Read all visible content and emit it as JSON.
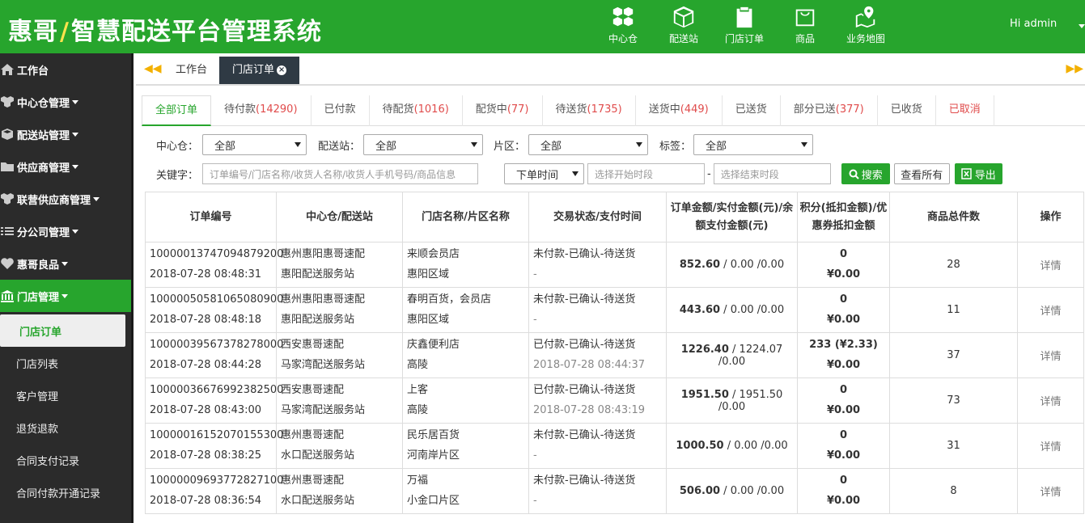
{
  "header": {
    "logo_main": "惠哥",
    "logo_bolt": "/",
    "logo_rest": "智慧配送平台管理系统",
    "nav": [
      {
        "label": "中心仓",
        "icon": "cubes-icon"
      },
      {
        "label": "配送站",
        "icon": "cube-icon"
      },
      {
        "label": "门店订单",
        "icon": "clipboard-icon"
      },
      {
        "label": "商品",
        "icon": "shopping-bag-icon"
      },
      {
        "label": "业务地图",
        "icon": "map-icon"
      }
    ],
    "user": "Hi admin"
  },
  "sidebar": {
    "items": [
      {
        "label": "工作台",
        "icon": "home-icon"
      },
      {
        "label": "中心仓管理",
        "icon": "cubes-icon"
      },
      {
        "label": "配送站管理",
        "icon": "cube-icon"
      },
      {
        "label": "供应商管理",
        "icon": "folder-icon"
      },
      {
        "label": "联营供应商管理",
        "icon": "cubes-icon"
      },
      {
        "label": "分公司管理",
        "icon": "list-icon"
      },
      {
        "label": "惠哥良品",
        "icon": "heart-icon"
      },
      {
        "label": "门店管理",
        "icon": "bank-icon"
      }
    ],
    "sub_items": [
      "门店订单",
      "门店列表",
      "客户管理",
      "退货退款",
      "合同支付记录",
      "合同付款开通记录"
    ]
  },
  "tabs": [
    "工作台",
    "门店订单"
  ],
  "status_tabs": [
    {
      "label": "全部订单",
      "count": ""
    },
    {
      "label": "待付款",
      "count": "(14290)"
    },
    {
      "label": "已付款",
      "count": ""
    },
    {
      "label": "待配货",
      "count": "(1016)"
    },
    {
      "label": "配货中",
      "count": "(77)"
    },
    {
      "label": "待送货",
      "count": "(1735)"
    },
    {
      "label": "送货中",
      "count": "(449)"
    },
    {
      "label": "已送货",
      "count": ""
    },
    {
      "label": "部分已送",
      "count": "(377)"
    },
    {
      "label": "已收货",
      "count": ""
    },
    {
      "label": "已取消",
      "count": ""
    }
  ],
  "filters": {
    "center_label": "中心仓：",
    "center_value": "全部",
    "station_label": "配送站：",
    "station_value": "全部",
    "area_label": "片区：",
    "area_value": "全部",
    "tag_label": "标签：",
    "tag_value": "全部",
    "keyword_label": "关键字：",
    "keyword_placeholder": "订单编号/门店名称/收货人名称/收货人手机号码/商品信息",
    "time_type": "下单时间",
    "start_placeholder": "选择开始时段",
    "dash": "-",
    "end_placeholder": "选择结束时段",
    "search_btn": "搜索",
    "view_all_btn": "查看所有",
    "export_btn": "导出"
  },
  "table": {
    "headers": [
      "订单编号",
      "中心仓/配送站",
      "门店名称/片区名称",
      "交易状态/支付时间",
      "订单金额/实付金额(元)/余额支付金额(元)",
      "积分(抵扣金额)/优惠券抵扣金额",
      "商品总件数",
      "操作"
    ],
    "rows": [
      {
        "order_no": "10000013747094879200",
        "order_time": "2018-07-28 08:48:31",
        "center": "惠州惠阳惠哥速配",
        "station": "惠阳配送服务站",
        "store": "来顺会员店",
        "area": "惠阳区域",
        "status": "未付款-已确认-待送货",
        "pay_time": "-",
        "amount": "852.60",
        "amount_rest": " / 0.00 /0.00",
        "points": "0",
        "coupon": "¥0.00",
        "qty": "28",
        "action": "详情"
      },
      {
        "order_no": "10000050581065080900",
        "order_time": "2018-07-28 08:48:18",
        "center": "惠州惠阳惠哥速配",
        "station": "惠阳配送服务站",
        "store": "春明百货，会员店",
        "area": "惠阳区域",
        "status": "未付款-已确认-待送货",
        "pay_time": "-",
        "amount": "443.60",
        "amount_rest": " / 0.00 /0.00",
        "points": "0",
        "coupon": "¥0.00",
        "qty": "11",
        "action": "详情"
      },
      {
        "order_no": "10000039567378278000",
        "order_time": "2018-07-28 08:44:28",
        "center": "西安惠哥速配",
        "station": "马家湾配送服务站",
        "store": "庆鑫便利店",
        "area": "高陵",
        "status": "已付款-已确认-待送货",
        "pay_time": "2018-07-28 08:44:37",
        "amount": "1226.40",
        "amount_rest": " / 1224.07 /0.00",
        "points": "233 (¥2.33)",
        "coupon": "¥0.00",
        "qty": "37",
        "action": "详情"
      },
      {
        "order_no": "10000036676992382500",
        "order_time": "2018-07-28 08:43:00",
        "center": "西安惠哥速配",
        "station": "马家湾配送服务站",
        "store": "上客",
        "area": "高陵",
        "status": "已付款-已确认-待送货",
        "pay_time": "2018-07-28 08:43:19",
        "amount": "1951.50",
        "amount_rest": " / 1951.50 /0.00",
        "points": "0",
        "coupon": "¥0.00",
        "qty": "73",
        "action": "详情"
      },
      {
        "order_no": "10000016152070155300",
        "order_time": "2018-07-28 08:38:25",
        "center": "惠州惠哥速配",
        "station": "水口配送服务站",
        "store": "民乐居百货",
        "area": "河南岸片区",
        "status": "未付款-已确认-待送货",
        "pay_time": "-",
        "amount": "1000.50",
        "amount_rest": " / 0.00 /0.00",
        "points": "0",
        "coupon": "¥0.00",
        "qty": "31",
        "action": "详情"
      },
      {
        "order_no": "10000009693772827100",
        "order_time": "2018-07-28 08:36:54",
        "center": "惠州惠哥速配",
        "station": "水口配送服务站",
        "store": "万福",
        "area": "小金口片区",
        "status": "未付款-已确认-待送货",
        "pay_time": "-",
        "amount": "506.00",
        "amount_rest": " / 0.00 /0.00",
        "points": "0",
        "coupon": "¥0.00",
        "qty": "8",
        "action": "详情"
      }
    ]
  }
}
